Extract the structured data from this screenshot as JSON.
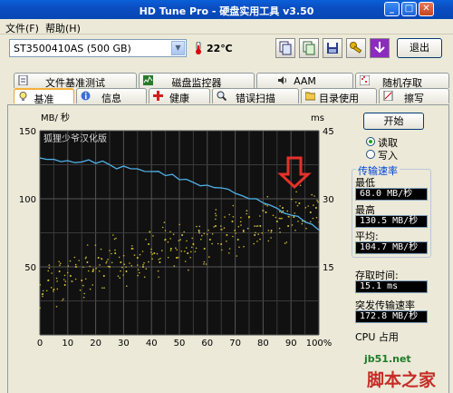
{
  "window": {
    "title": "HD Tune Pro - 硬盘实用工具 v3.50"
  },
  "menu": {
    "file": "文件(F)",
    "help": "帮助(H)"
  },
  "toolbar": {
    "drive": "ST3500410AS (500 GB)",
    "temperature": "22℃",
    "exit_label": "退出",
    "icons": [
      "copy-icon",
      "copy-all-icon",
      "save-icon",
      "key-icon",
      "download-icon"
    ]
  },
  "tabs_top": [
    "文件基准测试",
    "磁盘监控器",
    "AAM",
    "随机存取"
  ],
  "tabs_bottom": [
    "基准",
    "信息",
    "健康",
    "错误扫描",
    "目录使用",
    "擦写"
  ],
  "chart": {
    "left_unit": "MB/ 秒",
    "right_unit": "ms",
    "overlay_text": "狐狸少爷汉化版",
    "y_left_ticks": [
      "150",
      "100",
      "50",
      ""
    ],
    "y_right_ticks": [
      "45",
      "30",
      "15",
      ""
    ],
    "x_ticks": [
      "0",
      "10",
      "20",
      "30",
      "40",
      "50",
      "60",
      "70",
      "80",
      "90",
      "100%"
    ]
  },
  "chart_data": {
    "type": "line",
    "title": "",
    "xlabel": "",
    "ylabel": "MB/ 秒",
    "y2label": "ms",
    "xlim": [
      0,
      100
    ],
    "ylim": [
      0,
      150
    ],
    "y2lim": [
      0,
      45
    ],
    "grid": true,
    "series": [
      {
        "name": "",
        "axis": "left",
        "x": [
          0,
          5,
          10,
          15,
          20,
          25,
          30,
          35,
          40,
          45,
          50,
          55,
          60,
          65,
          70,
          75,
          80,
          85,
          90,
          95,
          100
        ],
        "values": [
          130,
          129,
          128,
          127,
          126,
          125,
          124,
          122,
          120,
          117,
          114,
          112,
          110,
          108,
          104,
          100,
          97,
          93,
          88,
          83,
          77
        ]
      },
      {
        "name": "",
        "type": "scatter",
        "axis": "right",
        "x": [
          1,
          3,
          5,
          7,
          9,
          11,
          13,
          15,
          17,
          19,
          21,
          23,
          25,
          27,
          29,
          31,
          33,
          35,
          37,
          39,
          41,
          43,
          45,
          47,
          49,
          51,
          53,
          55,
          57,
          59,
          61,
          63,
          65,
          67,
          69,
          71,
          73,
          75,
          77,
          79,
          81,
          83,
          85,
          87,
          89,
          91,
          93,
          95,
          97,
          99
        ],
        "values": [
          9,
          12,
          10,
          14,
          11,
          13,
          15,
          12,
          16,
          14,
          17,
          13,
          15,
          18,
          16,
          14,
          19,
          17,
          15,
          20,
          18,
          16,
          21,
          19,
          17,
          22,
          18,
          20,
          23,
          19,
          21,
          24,
          20,
          22,
          25,
          21,
          23,
          26,
          22,
          24,
          27,
          23,
          25,
          28,
          24,
          26,
          29,
          25,
          27,
          28
        ]
      }
    ]
  },
  "controls": {
    "start_label": "开始",
    "read_label": "读取",
    "write_label": "写入",
    "read_selected": true
  },
  "stats": {
    "transfer_rate_label": "传输速率",
    "min_label": "最低",
    "min_value": "68.0 MB/秒",
    "max_label": "最高",
    "max_value": "130.5 MB/秒",
    "avg_label": "平均:",
    "avg_value": "104.7 MB/秒",
    "access_label": "存取时间:",
    "access_value": "15.1 ms",
    "burst_label": "突发传输速率",
    "burst_value": "172.8 MB/秒",
    "cpu_label": "CPU 占用"
  },
  "watermark": {
    "site": "jb51.net",
    "name": "脚本之家"
  }
}
